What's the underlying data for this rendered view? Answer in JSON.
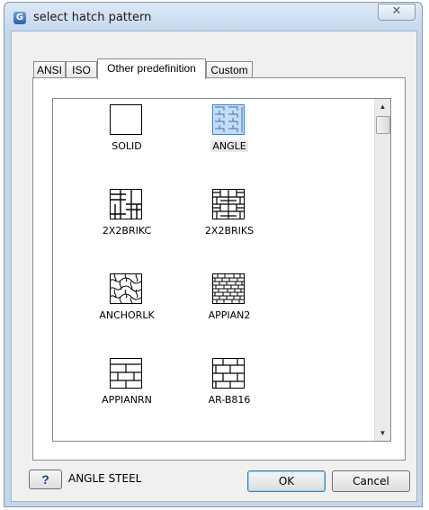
{
  "window": {
    "title": "select hatch pattern",
    "app_icon": "G"
  },
  "titlebar": {
    "close_glyph": "✕"
  },
  "tabs": [
    {
      "label": "ANSI",
      "active": false
    },
    {
      "label": "ISO",
      "active": false
    },
    {
      "label": "Other predefinition",
      "active": true
    },
    {
      "label": "Custom",
      "active": false
    }
  ],
  "patterns": [
    {
      "label": "SOLID",
      "icon": "solid-swatch-icon",
      "selected": false
    },
    {
      "label": "ANGLE",
      "icon": "angle-pattern-icon",
      "selected": true
    },
    {
      "label": "2X2BRIKC",
      "icon": "2x2brikc-pattern-icon",
      "selected": false
    },
    {
      "label": "2X2BRIKS",
      "icon": "2x2briks-pattern-icon",
      "selected": false
    },
    {
      "label": "ANCHORLK",
      "icon": "anchorlk-pattern-icon",
      "selected": false
    },
    {
      "label": "APPIAN2",
      "icon": "appian2-pattern-icon",
      "selected": false
    },
    {
      "label": "APPIANRN",
      "icon": "appianrn-pattern-icon",
      "selected": false
    },
    {
      "label": "AR-B816",
      "icon": "ar-b816-pattern-icon",
      "selected": false
    }
  ],
  "scrollbar": {
    "up_glyph": "▲",
    "down_glyph": "▼"
  },
  "footer": {
    "help_label": "?",
    "status_text": "ANGLE STEEL",
    "ok_label": "OK",
    "cancel_label": "Cancel"
  },
  "colors": {
    "selection_fill": "#c5dcf7",
    "selection_stroke": "#4a7fc1",
    "accent": "#1a3c9c"
  }
}
